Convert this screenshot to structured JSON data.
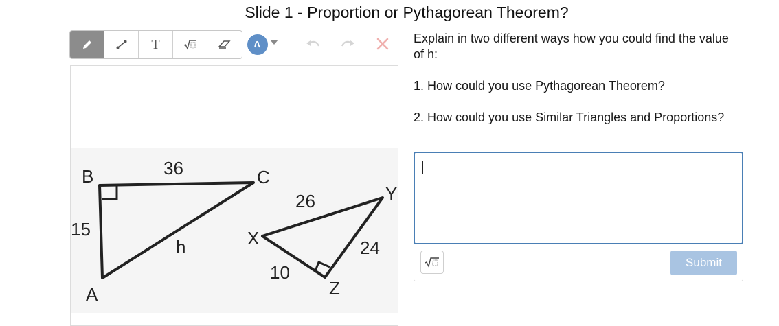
{
  "slide": {
    "title": "Slide 1 - Proportion or Pythagorean Theorem?"
  },
  "toolbar": {
    "tools": [
      {
        "name": "pencil-icon",
        "active": true
      },
      {
        "name": "line-icon",
        "active": false
      },
      {
        "name": "text-icon",
        "label": "T",
        "active": false
      },
      {
        "name": "math-icon",
        "active": false
      },
      {
        "name": "eraser-icon",
        "active": false
      }
    ],
    "pen_color": "#5f8fc7",
    "undo_icon": "undo-icon",
    "redo_icon": "redo-icon",
    "clear_icon": "clear-icon"
  },
  "figure": {
    "triangle_abc": {
      "vertex_a": "A",
      "vertex_b": "B",
      "vertex_c": "C",
      "side_bc": "36",
      "side_ab": "15",
      "side_ac": "h"
    },
    "triangle_xyz": {
      "vertex_x": "X",
      "vertex_y": "Y",
      "vertex_z": "Z",
      "side_xy": "26",
      "side_yz": "24",
      "side_xz": "10"
    }
  },
  "prompt": {
    "intro": "Explain in two different ways how you could find the value of h:",
    "question_1": "1. How could you use Pythagorean Theorem?",
    "question_2": "2. How could you use Similar Triangles and Proportions?"
  },
  "answer": {
    "value": "",
    "submit_label": "Submit",
    "math_button_icon": "sqrt-icon"
  }
}
